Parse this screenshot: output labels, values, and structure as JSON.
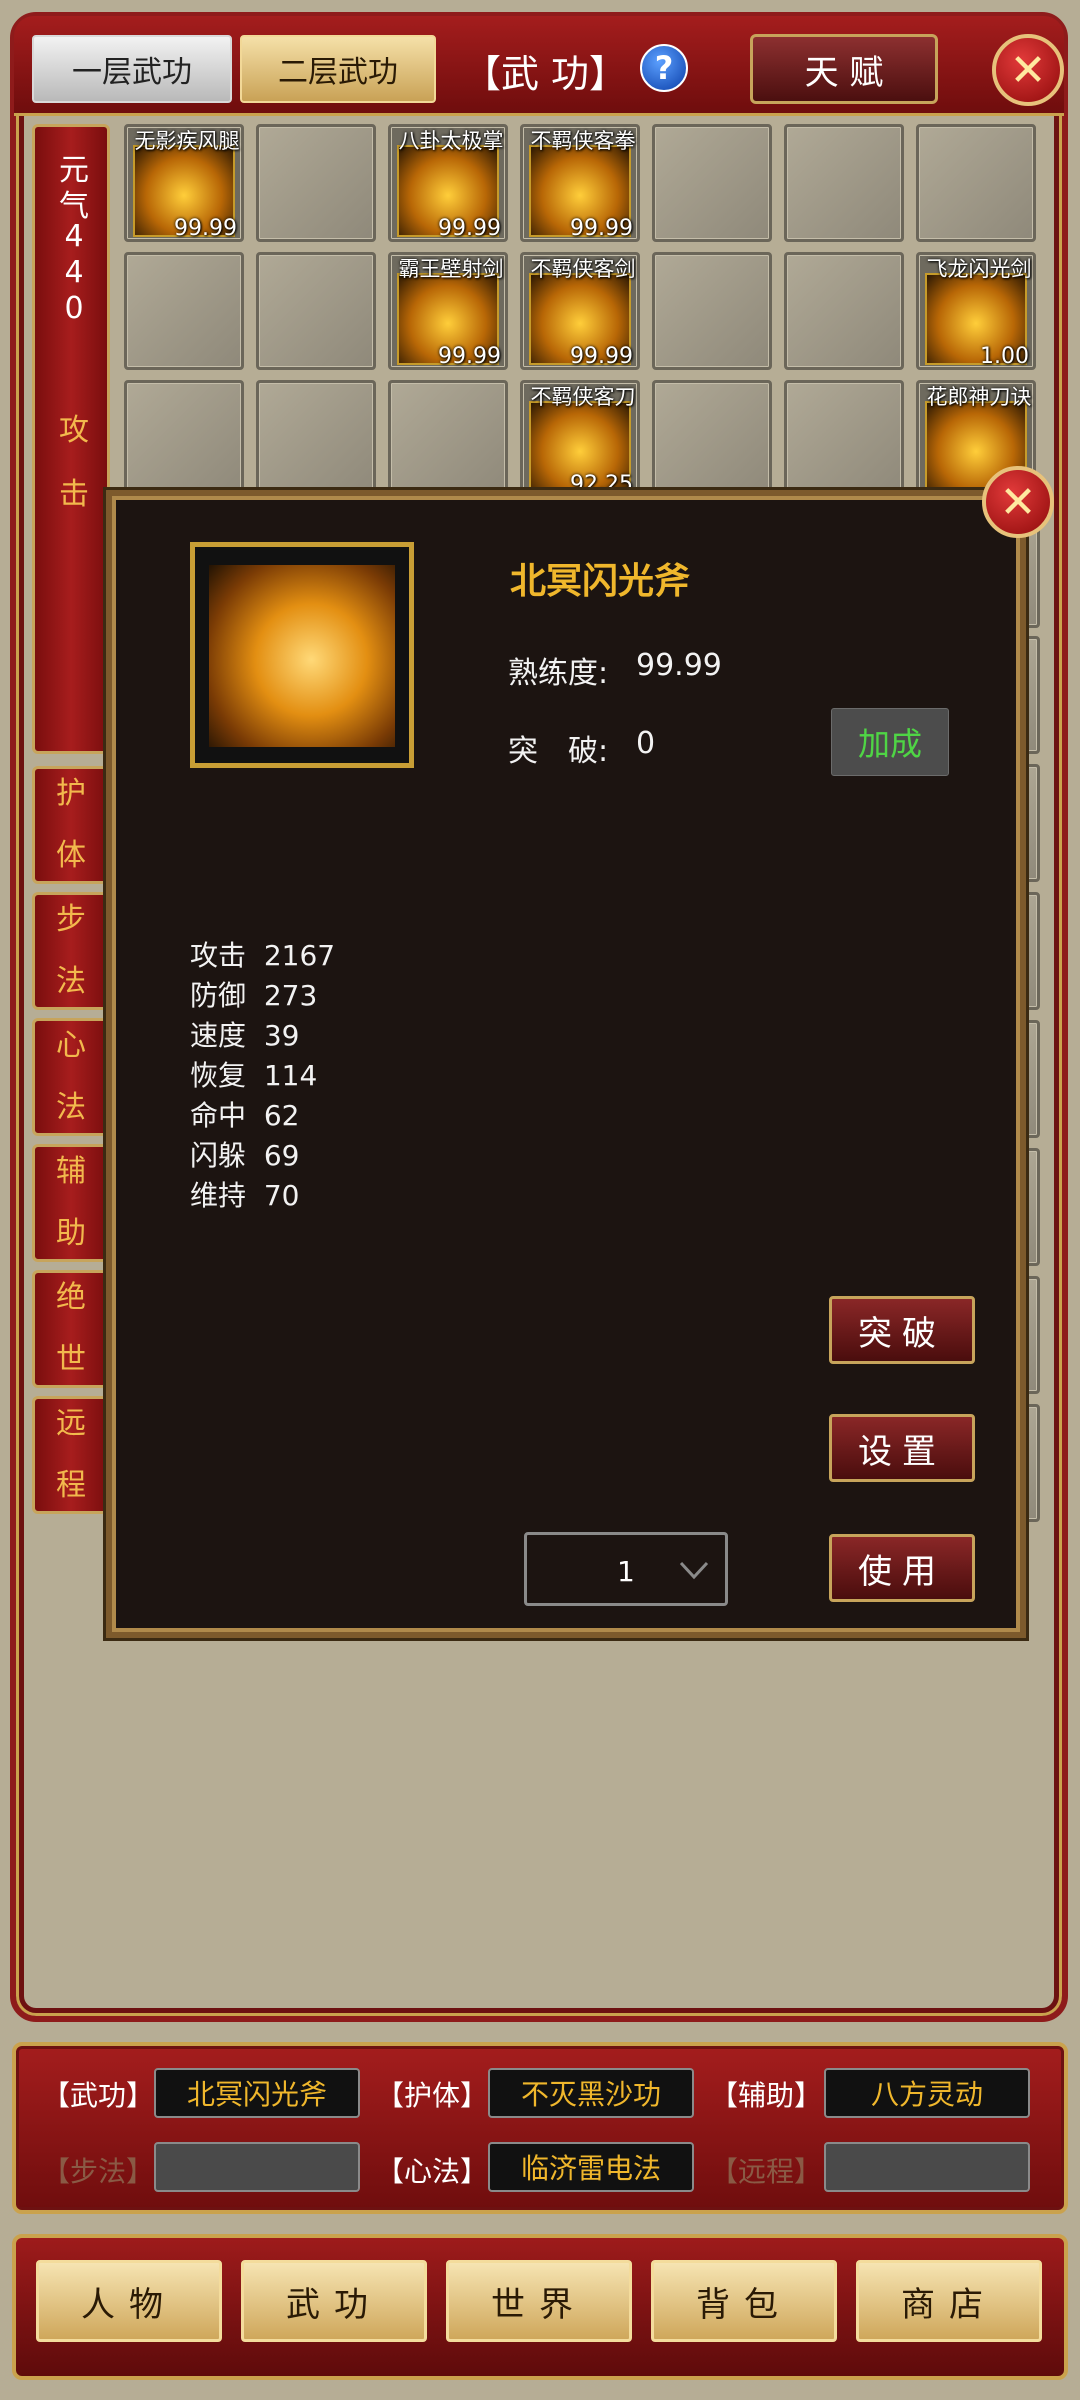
{
  "header": {
    "tab_layer1": "一层武功",
    "tab_layer2": "二层武功",
    "title": "【武  功】",
    "help": "?",
    "talent_button": "天 赋",
    "close": "✕"
  },
  "left_strip": {
    "yuanqi_label": [
      "元",
      "气"
    ],
    "yuanqi_value": [
      "4",
      "4",
      "0"
    ],
    "current_category": [
      "攻",
      "击"
    ]
  },
  "side_tabs": [
    {
      "line1": "护",
      "line2": "体"
    },
    {
      "line1": "步",
      "line2": "法"
    },
    {
      "line1": "心",
      "line2": "法"
    },
    {
      "line1": "辅",
      "line2": "助"
    },
    {
      "line1": "绝",
      "line2": "世"
    },
    {
      "line1": "远",
      "line2": "程"
    }
  ],
  "skills": [
    {
      "name": "无影疾风腿",
      "value": "99.99",
      "type": "fist"
    },
    {
      "name": "八卦太极掌",
      "value": "99.99",
      "type": "fist"
    },
    {
      "name": "不羁侠客拳",
      "value": "99.99",
      "type": "fist"
    },
    {
      "name": "霸王壁射剑",
      "value": "99.99",
      "type": "sword"
    },
    {
      "name": "不羁侠客剑",
      "value": "99.99",
      "type": "sword"
    },
    {
      "name": "飞龙闪光剑",
      "value": "1.00",
      "type": "sword"
    },
    {
      "name": "不羁侠客刀",
      "value": "92.25",
      "type": "blade"
    },
    {
      "name": "花郎神刀诀",
      "value": "",
      "type": "blade"
    }
  ],
  "popup": {
    "close": "✕",
    "skill_name": "北冥闪光斧",
    "proficiency_label": "熟练度:",
    "proficiency_value": "99.99",
    "breakthrough_label": "突　破:",
    "breakthrough_value": "0",
    "bonus_button": "加成",
    "stats": [
      {
        "label": "攻击",
        "value": "2167"
      },
      {
        "label": "防御",
        "value": "273"
      },
      {
        "label": "速度",
        "value": "39"
      },
      {
        "label": "恢复",
        "value": "114"
      },
      {
        "label": "命中",
        "value": "62"
      },
      {
        "label": "闪躲",
        "value": "69"
      },
      {
        "label": "维持",
        "value": "70"
      }
    ],
    "btn_breakthrough": "突破",
    "btn_settings": "设置",
    "btn_use": "使用",
    "quantity": "1"
  },
  "equipment": {
    "wugong_label": "【武功】",
    "wugong_value": "北冥闪光斧",
    "huti_label": "【护体】",
    "huti_value": "不灭黑沙功",
    "fuzhu_label": "【辅助】",
    "fuzhu_value": "八方灵动",
    "bufa_label": "【步法】",
    "bufa_value": "",
    "xinfa_label": "【心法】",
    "xinfa_value": "临济雷电法",
    "yuancheng_label": "【远程】",
    "yuancheng_value": ""
  },
  "nav": [
    {
      "label": "人物"
    },
    {
      "label": "武功"
    },
    {
      "label": "世界"
    },
    {
      "label": "背包"
    },
    {
      "label": "商店"
    }
  ],
  "colors": {
    "frame_red": "#8e1b1b",
    "gold": "#caa24d",
    "skill_name_gold": "#f0b72c",
    "bonus_green": "#4fd545"
  }
}
